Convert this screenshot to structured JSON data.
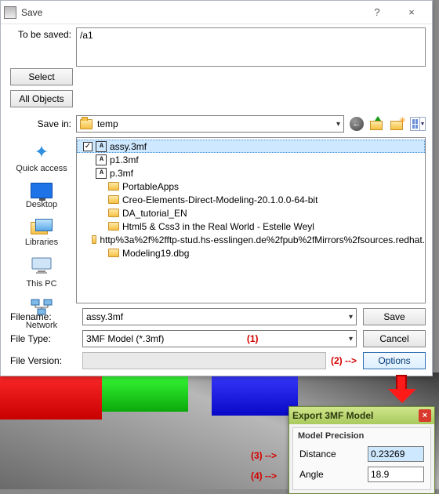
{
  "window": {
    "title": "Save",
    "help_glyph": "?",
    "close_glyph": "×"
  },
  "top": {
    "to_be_saved_label": "To be saved:",
    "to_be_saved_value": "/a1",
    "select_btn": "Select",
    "all_objects_btn": "All Objects"
  },
  "savein": {
    "label": "Save in:",
    "folder": "temp"
  },
  "places": {
    "quick_access": "Quick access",
    "desktop": "Desktop",
    "libraries": "Libraries",
    "this_pc": "This PC",
    "network": "Network"
  },
  "files": [
    {
      "indent": 0,
      "type": "3mf",
      "name": "assy.3mf",
      "checked": true,
      "selected": true
    },
    {
      "indent": 1,
      "type": "3mf",
      "name": "p1.3mf"
    },
    {
      "indent": 1,
      "type": "3mf",
      "name": "p.3mf"
    },
    {
      "indent": 2,
      "type": "folder",
      "name": "PortableApps"
    },
    {
      "indent": 2,
      "type": "folder",
      "name": "Creo-Elements-Direct-Modeling-20.1.0.0-64-bit"
    },
    {
      "indent": 2,
      "type": "folder",
      "name": "DA_tutorial_EN"
    },
    {
      "indent": 2,
      "type": "folder",
      "name": "Html5 & Css3 in the Real World - Estelle Weyl"
    },
    {
      "indent": 2,
      "type": "folder",
      "name": "http%3a%2f%2fftp-stud.hs-esslingen.de%2fpub%2fMirrors%2fsources.redhat."
    },
    {
      "indent": 2,
      "type": "folder",
      "name": "Modeling19.dbg"
    }
  ],
  "bottom": {
    "filename_label": "Filename:",
    "filename_value": "assy.3mf",
    "filetype_label": "File Type:",
    "filetype_value": "3MF Model (*.3mf)",
    "fileversion_label": "File Version:",
    "save_btn": "Save",
    "cancel_btn": "Cancel",
    "options_btn": "Options"
  },
  "annot": {
    "a1": "(1)",
    "a2": "(2) -->",
    "a3": "(3) -->",
    "a4": "(4) -->"
  },
  "panel": {
    "title": "Export 3MF Model",
    "group": "Model Precision",
    "distance_label": "Distance",
    "distance_value": "0.23269",
    "angle_label": "Angle",
    "angle_value": "18.9"
  }
}
